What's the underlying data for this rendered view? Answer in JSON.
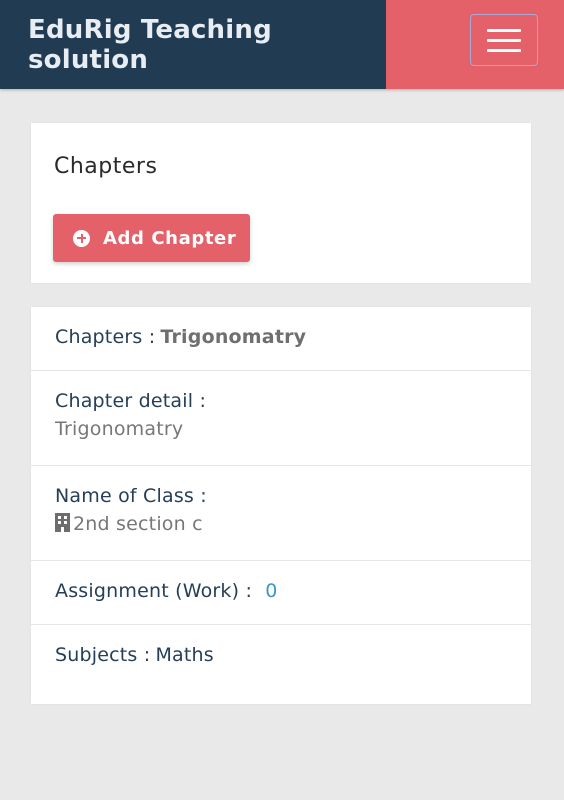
{
  "header": {
    "title": "EduRig Teaching solution",
    "menu_icon": "hamburger-icon",
    "brand_color": "#213b53",
    "accent_color": "#e4616a"
  },
  "chapters_card": {
    "title": "Chapters",
    "add_button_label": "Add Chapter",
    "add_button_icon": "plus-circle-icon"
  },
  "details": {
    "chapter_label": "Chapters :",
    "chapter_value": "Trigonomatry",
    "detail_label": "Chapter detail :",
    "detail_value": "Trigonomatry",
    "class_label": "Name of Class :",
    "class_icon": "building-icon",
    "class_value": "2nd section c",
    "assignment_label": "Assignment (Work) :",
    "assignment_value": "0",
    "subjects_label": "Subjects :",
    "subjects_value": "Maths"
  }
}
